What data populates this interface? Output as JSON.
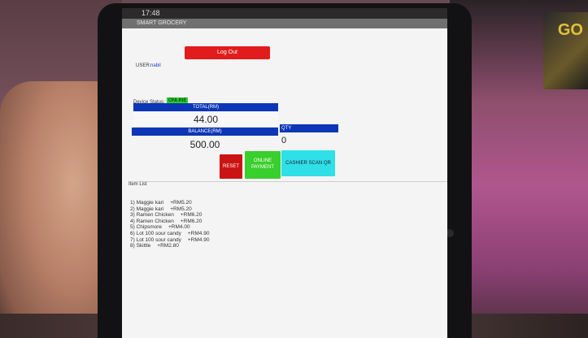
{
  "status_bar": {
    "time": "17:48"
  },
  "app": {
    "title": "SMART GROCERY"
  },
  "user": {
    "label": "USER:",
    "value": "nabil"
  },
  "logout_label": "Log Out",
  "device": {
    "label": "Device Status:",
    "status": "ONLINE"
  },
  "total": {
    "header": "TOTAL(RM)",
    "value": "44.00"
  },
  "balance": {
    "header": "BALANCE(RM)",
    "value": "500.00"
  },
  "qty": {
    "header": "QTY",
    "value": "0"
  },
  "buttons": {
    "reset": "RESET",
    "online_line1": "ONLINE",
    "online_line2": "PAYMENT",
    "cashier": "CASHIER SCAN QR"
  },
  "item_list": {
    "label": "Item List",
    "items": [
      {
        "name": "1) Maggie kari",
        "price": "+RM5.20"
      },
      {
        "name": "2) Maggie kari",
        "price": "+RM5.20"
      },
      {
        "name": "3) Ramen Chicken",
        "price": "+RM6.20"
      },
      {
        "name": "4) Ramen Chicken",
        "price": "+RM6.20"
      },
      {
        "name": "5) Chipsmore",
        "price": "+RM4.00"
      },
      {
        "name": "6) Lot 100 sour candy",
        "price": "+RM4.90"
      },
      {
        "name": "7) Lot 100 sour candy",
        "price": "+RM4.90"
      },
      {
        "name": "8) Skittle",
        "price": "+RM2.80"
      }
    ]
  },
  "background": {
    "shelf_text": "GO"
  },
  "colors": {
    "blue_header": "#0c36b5",
    "logout": "#e21c1c",
    "reset": "#cc1313",
    "online_payment": "#39cf2d",
    "cashier": "#2fe0e8",
    "online_status": "#22d12a"
  }
}
